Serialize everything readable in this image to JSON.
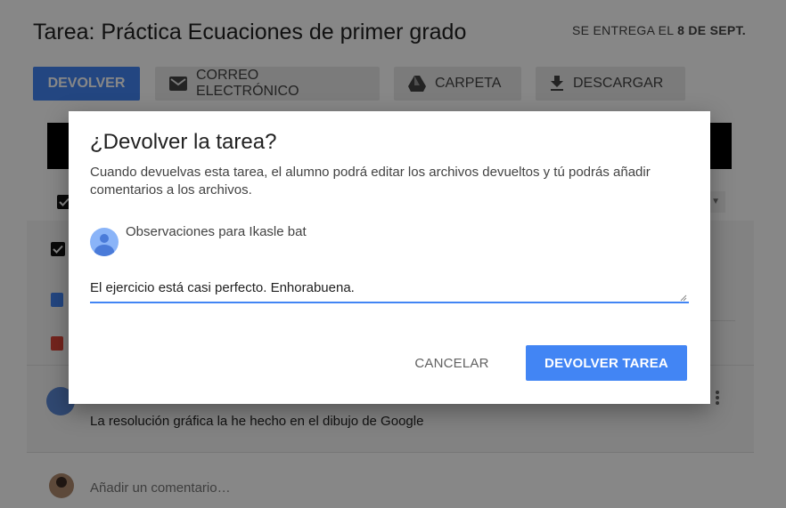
{
  "assignment": {
    "title": "Tarea: Práctica Ecuaciones de primer grado",
    "due_prefix": "SE ENTREGA EL",
    "due_date": "8 DE SEPT."
  },
  "toolbar": {
    "return_label": "DEVOLVER",
    "email_label": "CORREO ELECTRÓNICO",
    "folder_label": "CARPETA",
    "download_label": "DESCARGAR"
  },
  "submission": {
    "comment_text": "La resolución gráfica la he hecho en el dibujo de Google",
    "add_comment_placeholder": "Añadir un comentario…"
  },
  "dialog": {
    "title": "¿Devolver la tarea?",
    "body": "Cuando devuelvas esta tarea, el alumno podrá editar los archivos devueltos y tú podrás añadir comentarios a los archivos.",
    "observations_label": "Observaciones para Ikasle bat",
    "feedback_value": "El ejercicio está casi perfecto. Enhorabuena.",
    "cancel_label": "CANCELAR",
    "confirm_label": "DEVOLVER TAREA"
  },
  "icons": {
    "email": "mail-icon",
    "folder": "drive-icon",
    "download": "download-icon",
    "doc": "google-doc-icon",
    "drawing": "google-drawing-icon",
    "more": "more-vert-icon"
  },
  "colors": {
    "accent": "#4285f4",
    "scrim": "rgba(0,0,0,0.47)"
  }
}
